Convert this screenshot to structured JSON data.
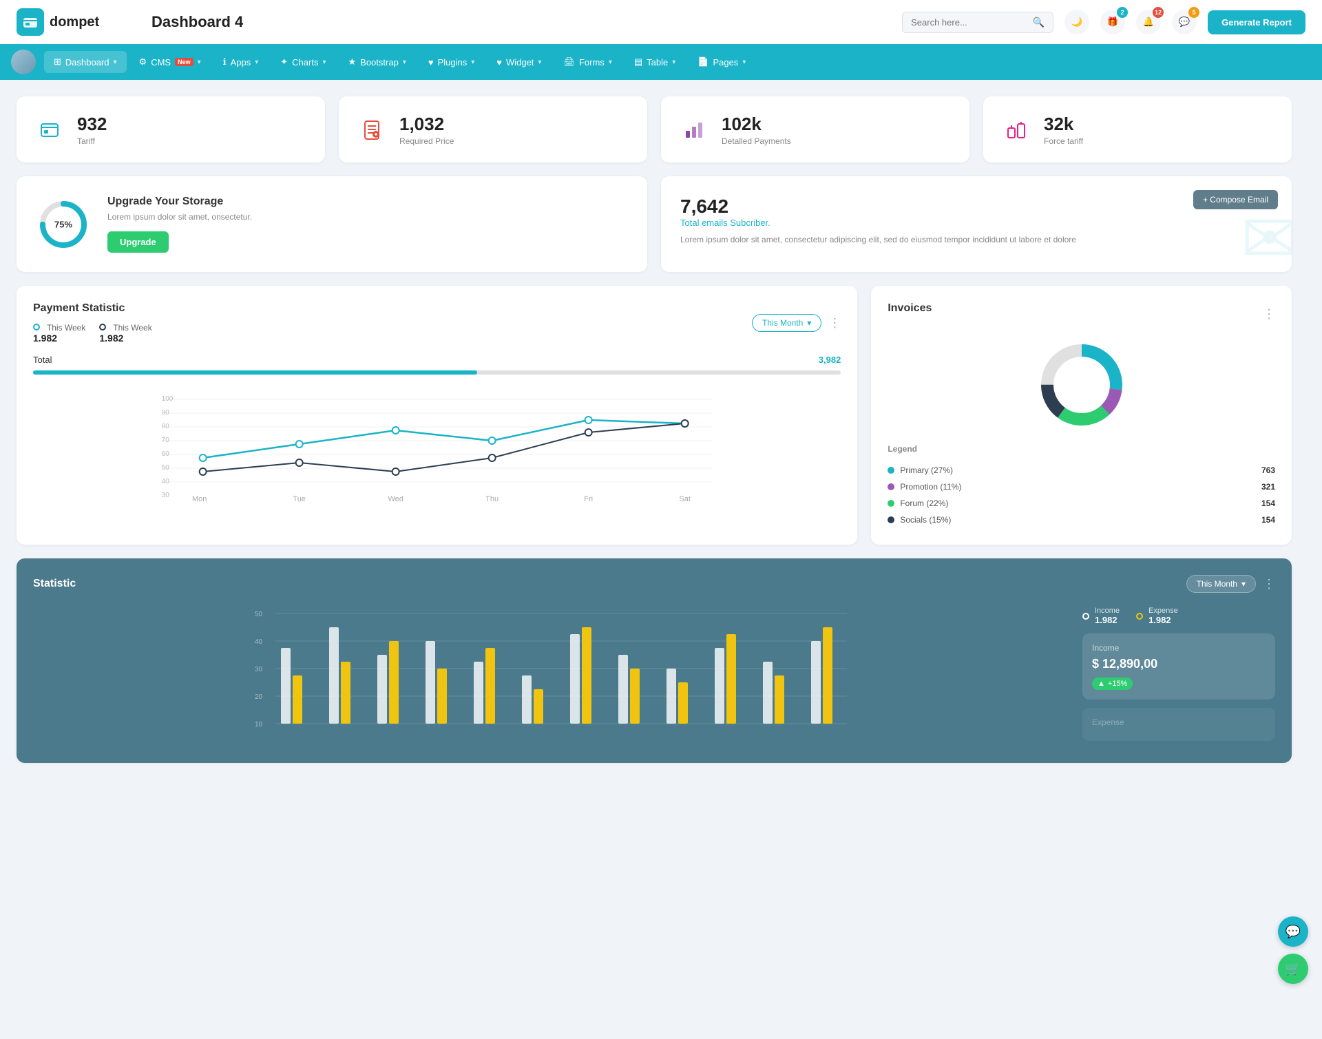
{
  "header": {
    "logo_text": "dompet",
    "page_title": "Dashboard 4",
    "search_placeholder": "Search here...",
    "generate_btn": "Generate Report",
    "icons": {
      "moon": "🌙",
      "gift": "🎁",
      "bell": "🔔",
      "chat": "💬"
    },
    "badges": {
      "gift": "2",
      "bell": "12",
      "chat": "5"
    }
  },
  "navbar": {
    "items": [
      {
        "label": "Dashboard",
        "active": true,
        "has_chevron": true
      },
      {
        "label": "CMS",
        "has_badge": true,
        "badge": "New",
        "has_chevron": true
      },
      {
        "label": "Apps",
        "has_chevron": true
      },
      {
        "label": "Charts",
        "has_chevron": true
      },
      {
        "label": "Bootstrap",
        "has_chevron": true
      },
      {
        "label": "Plugins",
        "has_chevron": true
      },
      {
        "label": "Widget",
        "has_chevron": true
      },
      {
        "label": "Forms",
        "has_chevron": true
      },
      {
        "label": "Table",
        "has_chevron": true
      },
      {
        "label": "Pages",
        "has_chevron": true
      }
    ]
  },
  "stat_cards": [
    {
      "number": "932",
      "label": "Tariff",
      "icon_type": "teal",
      "icon": "🗂"
    },
    {
      "number": "1,032",
      "label": "Required Price",
      "icon_type": "red",
      "icon": "📄"
    },
    {
      "number": "102k",
      "label": "Detalled Payments",
      "icon_type": "purple",
      "icon": "📊"
    },
    {
      "number": "32k",
      "label": "Force tariff",
      "icon_type": "pink",
      "icon": "🏢"
    }
  ],
  "storage": {
    "percent": "75%",
    "title": "Upgrade Your Storage",
    "description": "Lorem ipsum dolor sit amet, onsectetur.",
    "btn_label": "Upgrade",
    "donut_percent": 75
  },
  "email": {
    "number": "7,642",
    "subtitle": "Total emails Subcriber.",
    "description": "Lorem ipsum dolor sit amet, consectetur adipiscing elit, sed do eiusmod tempor incididunt ut labore et dolore",
    "compose_btn": "+ Compose Email"
  },
  "payment": {
    "title": "Payment Statistic",
    "this_week_1_label": "This Week",
    "this_week_1_value": "1.982",
    "this_week_2_label": "This Week",
    "this_week_2_value": "1.982",
    "filter_btn": "This Month",
    "total_label": "Total",
    "total_value": "3,982",
    "x_axis": [
      "Mon",
      "Tue",
      "Wed",
      "Thu",
      "Fri",
      "Sat"
    ],
    "y_axis": [
      "100",
      "90",
      "80",
      "70",
      "60",
      "50",
      "40",
      "30"
    ],
    "line1_points": "40,148 120,108 220,88 340,68 480,88 620,52 760,60",
    "line2_points": "40,128 120,118 220,108 340,128 480,108 620,68 760,52"
  },
  "invoices": {
    "title": "Invoices",
    "legend_title": "Legend",
    "items": [
      {
        "label": "Primary (27%)",
        "color": "#1ab3c8",
        "value": "763"
      },
      {
        "label": "Promotion (11%)",
        "color": "#9b59b6",
        "value": "321"
      },
      {
        "label": "Forum (22%)",
        "color": "#2ecc71",
        "value": "154"
      },
      {
        "label": "Socials (15%)",
        "color": "#2c3e50",
        "value": "154"
      }
    ]
  },
  "statistic": {
    "title": "Statistic",
    "filter_btn": "This Month",
    "income_label": "Income",
    "income_value": "1.982",
    "expense_label": "Expense",
    "expense_value": "1.982",
    "y_axis": [
      "50",
      "40",
      "30",
      "20",
      "10"
    ],
    "income_box": {
      "title": "Income",
      "amount": "$ 12,890,00",
      "badge": "+15%"
    },
    "expense_box": {
      "title": "Expense"
    }
  }
}
